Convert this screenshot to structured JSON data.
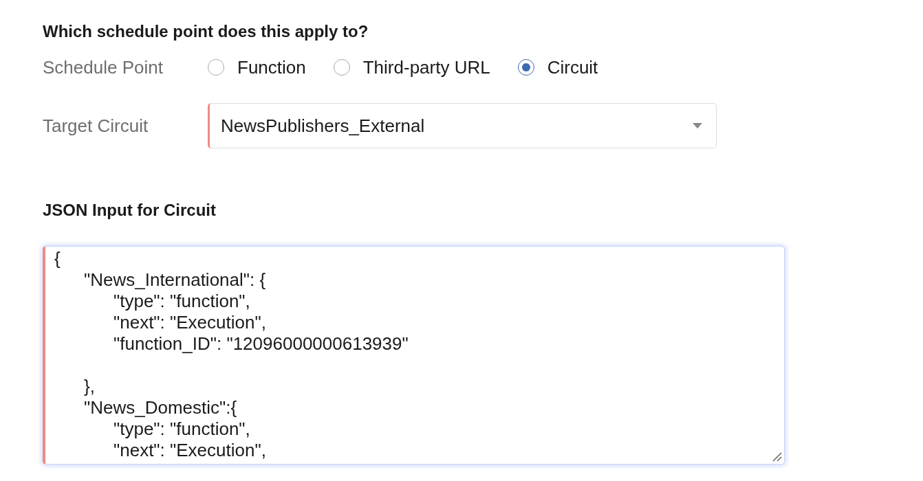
{
  "heading": "Which schedule point does this apply to?",
  "schedule_point": {
    "label": "Schedule Point",
    "options": [
      {
        "label": "Function",
        "selected": false
      },
      {
        "label": "Third-party URL",
        "selected": false
      },
      {
        "label": "Circuit",
        "selected": true
      }
    ]
  },
  "target_circuit": {
    "label": "Target Circuit",
    "value": "NewsPublishers_External",
    "mandatory": true
  },
  "json_input": {
    "heading": "JSON Input for Circuit",
    "value": "{\n\t\"News_International\": {\n\t\t\"type\": \"function\",\n\t\t\"next\": \"Execution\",\n\t\t\"function_ID\": \"12096000000613939\"\n\n\t},\n\t\"News_Domestic\":{\n\t\t\"type\": \"function\",\n\t\t\"next\": \"Execution\",",
    "mandatory": true,
    "focused": true
  }
}
